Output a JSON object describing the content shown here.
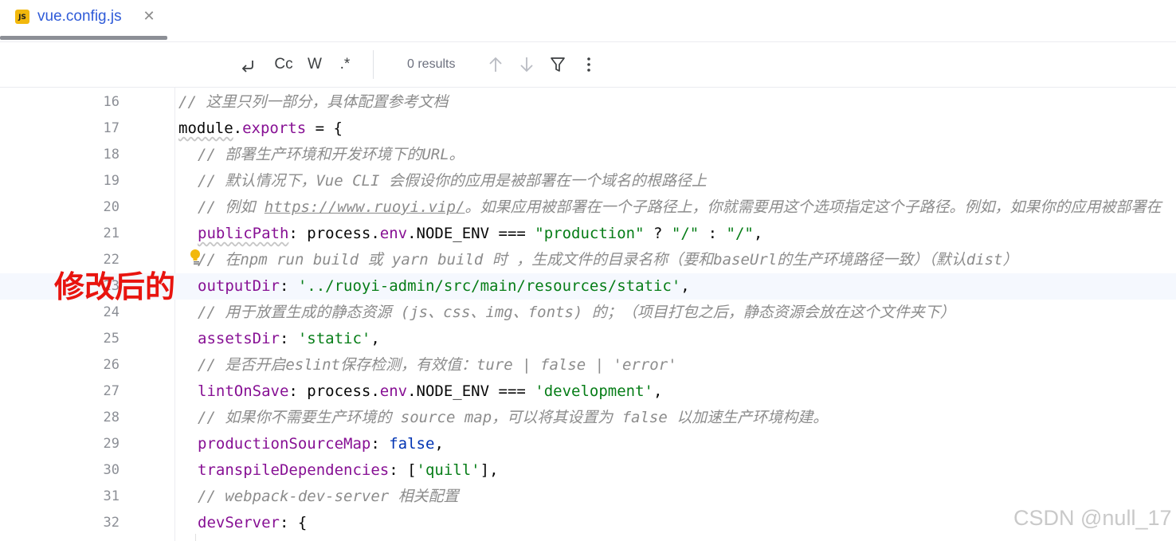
{
  "tab": {
    "icon_text": "JS",
    "label": "vue.config.js",
    "close": "✕"
  },
  "search_toolbar": {
    "regex_label": ".*",
    "case_label": "Cc",
    "word_label": "W",
    "results": "0 results"
  },
  "annotation": "修改后的",
  "watermark": "CSDN @null_17",
  "colors": {
    "comment": "#8c8c8c",
    "property": "#871094",
    "string": "#067d17",
    "boolean": "#0033b3",
    "annotation": "#e8140f",
    "tab_label": "#2f5bd8"
  },
  "editor": {
    "lines": [
      {
        "n": "16",
        "t": [
          "// 这里只列一部分，具体配置参考文档"
        ]
      },
      {
        "n": "17",
        "t": [
          "module",
          ".",
          "exports",
          " = {"
        ]
      },
      {
        "n": "18",
        "t": [
          "// 部署生产环境和开发环境下的URL。"
        ]
      },
      {
        "n": "19",
        "t": [
          "// 默认情况下，Vue CLI 会假设你的应用是被部署在一个域名的根路径上"
        ]
      },
      {
        "n": "20",
        "t": [
          "// 例如 ",
          "https://www.ruoyi.vip/",
          "。如果应用被部署在一个子路径上，你就需要用这个选项指定这个子路径。例如，如果你的应用被部署在"
        ]
      },
      {
        "n": "21",
        "t": [
          "publicPath",
          ": process.",
          "env",
          ".NODE_ENV === ",
          "\"production\"",
          " ? ",
          "\"/\"",
          " : ",
          "\"/\"",
          ","
        ]
      },
      {
        "n": "22",
        "t": [
          "// 在npm run build 或 yarn build 时 ，生成文件的目录名称（要和baseUrl的生产环境路径一致）（默认dist）"
        ]
      },
      {
        "n": "23",
        "t": [
          "outputDir",
          ": ",
          "'../ruoyi-admin/src/main/resources/static'",
          ","
        ]
      },
      {
        "n": "24",
        "t": [
          "// 用于放置生成的静态资源 (js、css、img、fonts) 的；（项目打包之后，静态资源会放在这个文件夹下）"
        ]
      },
      {
        "n": "25",
        "t": [
          "assetsDir",
          ": ",
          "'static'",
          ","
        ]
      },
      {
        "n": "26",
        "t": [
          "// 是否开启eslint保存检测，有效值：ture | false | 'error'"
        ]
      },
      {
        "n": "27",
        "t": [
          "lintOnSave",
          ": process.",
          "env",
          ".NODE_ENV === ",
          "'development'",
          ","
        ]
      },
      {
        "n": "28",
        "t": [
          "// 如果你不需要生产环境的 source map，可以将其设置为 false 以加速生产环境构建。"
        ]
      },
      {
        "n": "29",
        "t": [
          "productionSourceMap",
          ": ",
          "false",
          ","
        ]
      },
      {
        "n": "30",
        "t": [
          "transpileDependencies",
          ": [",
          "'quill'",
          "],"
        ]
      },
      {
        "n": "31",
        "t": [
          "// webpack-dev-server 相关配置"
        ]
      },
      {
        "n": "32",
        "t": [
          "devServer",
          ": {"
        ]
      }
    ]
  }
}
